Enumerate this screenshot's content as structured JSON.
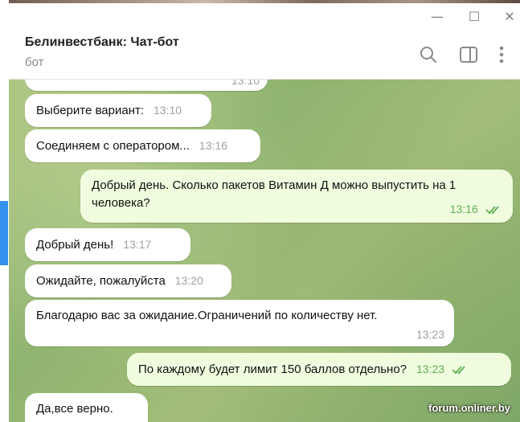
{
  "window": {
    "controls": {
      "minimize": "—",
      "maximize": "☐",
      "close": "✕"
    }
  },
  "header": {
    "title": "Белинвестбанк: Чат-бот",
    "subtitle": "бот",
    "icons": [
      "search-icon",
      "sidebar-toggle-icon",
      "more-vertical-icon"
    ]
  },
  "messages": [
    {
      "direction": "incoming",
      "text": "",
      "time": "13:10",
      "partial": true
    },
    {
      "direction": "incoming",
      "text": "Выберите вариант:",
      "time": "13:10"
    },
    {
      "direction": "incoming",
      "text": "Соединяем с оператором...",
      "time": "13:16"
    },
    {
      "direction": "outgoing",
      "text": "Добрый день. Сколько пакетов Витамин Д можно выпустить на 1 человека?",
      "time": "13:16",
      "read": true
    },
    {
      "direction": "incoming",
      "text": "Добрый день!",
      "time": "13:17"
    },
    {
      "direction": "incoming",
      "text": "Ожидайте, пожалуйста",
      "time": "13:20"
    },
    {
      "direction": "incoming",
      "text": "Благодарю вас за ожидание.Ограничений по количеству нет.",
      "time": "13:23"
    },
    {
      "direction": "outgoing",
      "text": "По каждому будет лимит 150 баллов отдельно?",
      "time": "13:23",
      "read": true
    },
    {
      "direction": "incoming",
      "text": "Да,все верно.",
      "time": ""
    }
  ],
  "watermark": "forum.onliner.by",
  "colors": {
    "incoming_bubble": "#ffffff",
    "outgoing_bubble": "#effdde",
    "read_ticks": "#62ad55",
    "accent": "#3390ec"
  }
}
